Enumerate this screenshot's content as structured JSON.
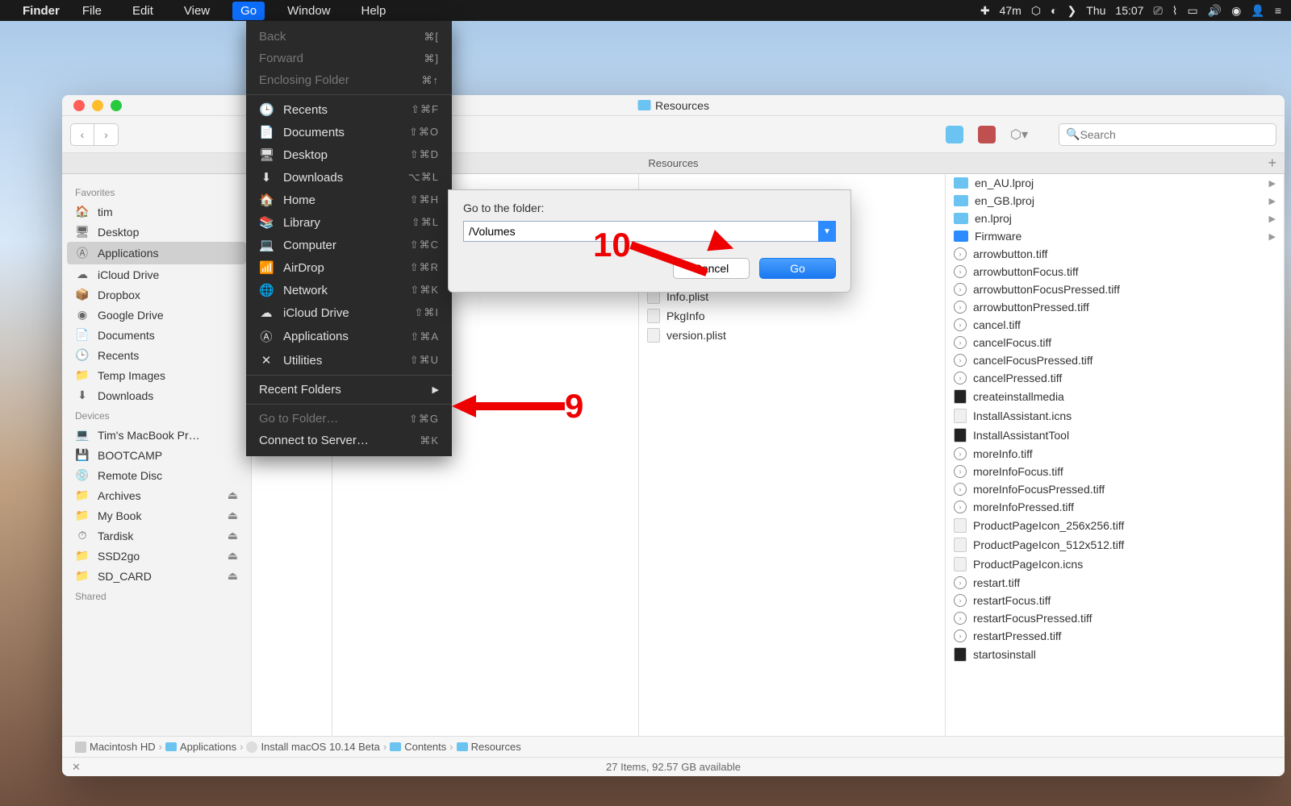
{
  "menubar": {
    "app": "Finder",
    "items": [
      "File",
      "Edit",
      "View",
      "Go",
      "Window",
      "Help"
    ],
    "active_index": 3,
    "status": {
      "battery": "47m",
      "day": "Thu",
      "time": "15:07"
    }
  },
  "go_menu": {
    "nav": [
      {
        "label": "Back",
        "shortcut": "⌘[",
        "disabled": true
      },
      {
        "label": "Forward",
        "shortcut": "⌘]",
        "disabled": true
      },
      {
        "label": "Enclosing Folder",
        "shortcut": "⌘↑",
        "disabled": true
      }
    ],
    "places": [
      {
        "icon": "🕒",
        "label": "Recents",
        "shortcut": "⇧⌘F"
      },
      {
        "icon": "📄",
        "label": "Documents",
        "shortcut": "⇧⌘O"
      },
      {
        "icon": "🖥",
        "label": "Desktop",
        "shortcut": "⇧⌘D"
      },
      {
        "icon": "⬇",
        "label": "Downloads",
        "shortcut": "⌥⌘L"
      },
      {
        "icon": "🏠",
        "label": "Home",
        "shortcut": "⇧⌘H"
      },
      {
        "icon": "📚",
        "label": "Library",
        "shortcut": "⇧⌘L"
      },
      {
        "icon": "💻",
        "label": "Computer",
        "shortcut": "⇧⌘C"
      },
      {
        "icon": "📶",
        "label": "AirDrop",
        "shortcut": "⇧⌘R"
      },
      {
        "icon": "🌐",
        "label": "Network",
        "shortcut": "⇧⌘K"
      },
      {
        "icon": "☁",
        "label": "iCloud Drive",
        "shortcut": "⇧⌘I"
      },
      {
        "icon": "Ⓐ",
        "label": "Applications",
        "shortcut": "⇧⌘A"
      },
      {
        "icon": "✕",
        "label": "Utilities",
        "shortcut": "⇧⌘U"
      }
    ],
    "recent_label": "Recent Folders",
    "goto": {
      "label": "Go to Folder…",
      "shortcut": "⇧⌘G"
    },
    "connect": {
      "label": "Connect to Server…",
      "shortcut": "⌘K"
    }
  },
  "window": {
    "title": "Resources",
    "tab": "Resources",
    "search_placeholder": "Search"
  },
  "sidebar": {
    "favorites_label": "Favorites",
    "favorites": [
      {
        "icon": "🏠",
        "label": "tim"
      },
      {
        "icon": "🖥",
        "label": "Desktop"
      },
      {
        "icon": "Ⓐ",
        "label": "Applications",
        "selected": true
      },
      {
        "icon": "☁",
        "label": "iCloud Drive"
      },
      {
        "icon": "📦",
        "label": "Dropbox"
      },
      {
        "icon": "◉",
        "label": "Google Drive"
      },
      {
        "icon": "📄",
        "label": "Documents"
      },
      {
        "icon": "🕒",
        "label": "Recents"
      },
      {
        "icon": "📁",
        "label": "Temp Images"
      },
      {
        "icon": "⬇",
        "label": "Downloads"
      }
    ],
    "devices_label": "Devices",
    "devices": [
      {
        "icon": "💻",
        "label": "Tim's MacBook Pr…"
      },
      {
        "icon": "💾",
        "label": "BOOTCAMP"
      },
      {
        "icon": "💿",
        "label": "Remote Disc"
      },
      {
        "icon": "📁",
        "label": "Archives",
        "eject": true
      },
      {
        "icon": "📁",
        "label": "My Book",
        "eject": true
      },
      {
        "icon": "⏱",
        "label": "Tardisk",
        "eject": true
      },
      {
        "icon": "📁",
        "label": "SSD2go",
        "eject": true
      },
      {
        "icon": "📁",
        "label": "SD_CARD",
        "eject": true
      }
    ],
    "shared_label": "Shared"
  },
  "columns": {
    "col3": [
      {
        "label": "Info.plist",
        "type": "file"
      },
      {
        "label": "PkgInfo",
        "type": "file"
      },
      {
        "label": "version.plist",
        "type": "file"
      }
    ],
    "col4": [
      {
        "label": "en_AU.lproj",
        "type": "folder",
        "arrow": true
      },
      {
        "label": "en_GB.lproj",
        "type": "folder",
        "arrow": true
      },
      {
        "label": "en.lproj",
        "type": "folder",
        "arrow": true
      },
      {
        "label": "Firmware",
        "type": "folder-blue",
        "arrow": true
      },
      {
        "label": "arrowbutton.tiff",
        "type": "circ"
      },
      {
        "label": "arrowbuttonFocus.tiff",
        "type": "circ"
      },
      {
        "label": "arrowbuttonFocusPressed.tiff",
        "type": "circ"
      },
      {
        "label": "arrowbuttonPressed.tiff",
        "type": "circ"
      },
      {
        "label": "cancel.tiff",
        "type": "circ"
      },
      {
        "label": "cancelFocus.tiff",
        "type": "circ"
      },
      {
        "label": "cancelFocusPressed.tiff",
        "type": "circ"
      },
      {
        "label": "cancelPressed.tiff",
        "type": "circ"
      },
      {
        "label": "createinstallmedia",
        "type": "exec"
      },
      {
        "label": "InstallAssistant.icns",
        "type": "file"
      },
      {
        "label": "InstallAssistantTool",
        "type": "exec"
      },
      {
        "label": "moreInfo.tiff",
        "type": "circ"
      },
      {
        "label": "moreInfoFocus.tiff",
        "type": "circ"
      },
      {
        "label": "moreInfoFocusPressed.tiff",
        "type": "circ"
      },
      {
        "label": "moreInfoPressed.tiff",
        "type": "circ"
      },
      {
        "label": "ProductPageIcon_256x256.tiff",
        "type": "file"
      },
      {
        "label": "ProductPageIcon_512x512.tiff",
        "type": "file"
      },
      {
        "label": "ProductPageIcon.icns",
        "type": "file"
      },
      {
        "label": "restart.tiff",
        "type": "circ"
      },
      {
        "label": "restartFocus.tiff",
        "type": "circ"
      },
      {
        "label": "restartFocusPressed.tiff",
        "type": "circ"
      },
      {
        "label": "restartPressed.tiff",
        "type": "circ"
      },
      {
        "label": "startosinstall",
        "type": "exec"
      }
    ]
  },
  "pathbar": [
    "Macintosh HD",
    "Applications",
    "Install macOS 10.14 Beta",
    "Contents",
    "Resources"
  ],
  "statusbar": "27 Items, 92.57 GB available",
  "dialog": {
    "label": "Go to the folder:",
    "value": "/Volumes",
    "cancel": "Cancel",
    "go": "Go"
  },
  "annotations": {
    "a9": "9",
    "a10": "10"
  }
}
